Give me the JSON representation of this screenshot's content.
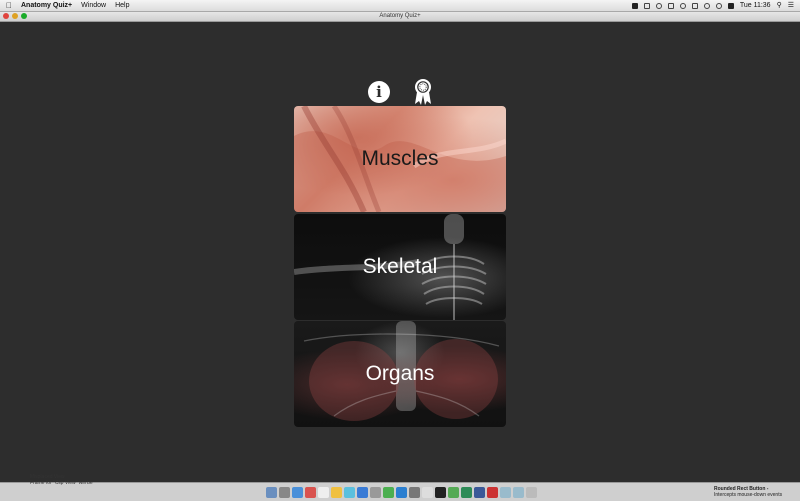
{
  "menubar": {
    "app_name": "Anatomy Quiz+",
    "menus": [
      "Window",
      "Help"
    ],
    "clock": "Tue 11:36"
  },
  "window": {
    "title": "Anatomy Quiz+"
  },
  "toolbar": {
    "info_glyph": "i",
    "info_icon": "info-icon",
    "award_icon": "award-ribbon-icon"
  },
  "categories": [
    {
      "label": "Muscles"
    },
    {
      "label": "Skeletal"
    },
    {
      "label": "Organs"
    }
  ],
  "xcode_issues": {
    "line1": "Misplaced View",
    "line2": "Frame for \"Clip View\" will be"
  },
  "library_item": {
    "title": "Rounded Rect Button -",
    "subtitle": "Intercepts mouse-down events"
  },
  "colors": {
    "background": "#2d2d2d",
    "close": "#e0443e",
    "minimize": "#dea123",
    "maximize": "#1aab29"
  }
}
